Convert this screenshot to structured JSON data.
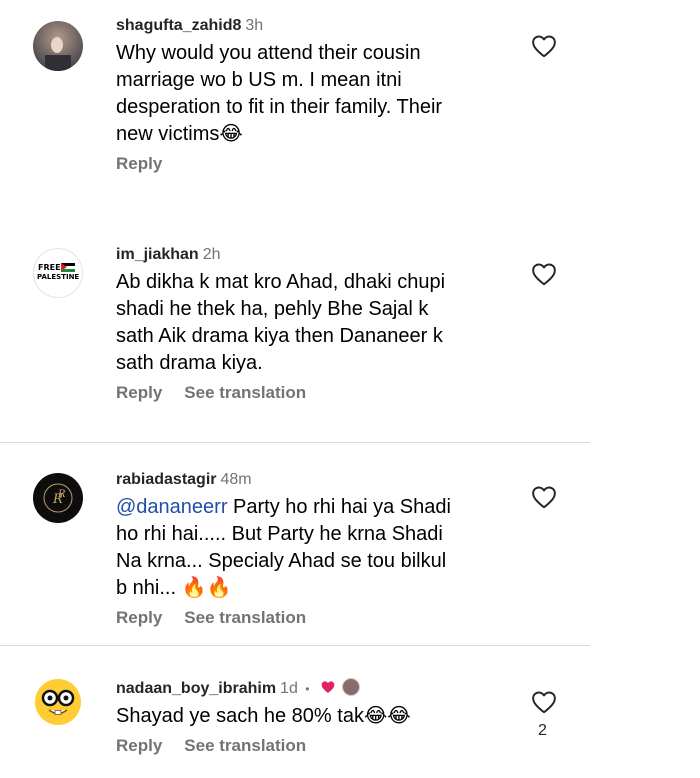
{
  "comments": [
    {
      "username": "shagufta_zahid8",
      "time": "3h",
      "lines": [
        "Why would you attend their cousin",
        "marriage wo b US m. I mean itni",
        "desperation to fit in their family. Their",
        "new victims😂"
      ],
      "reply_label": "Reply"
    },
    {
      "username": "im_jiakhan",
      "time": "2h",
      "avatar_text": [
        "FREE",
        "PALESTINE"
      ],
      "lines": [
        "Ab dikha k mat kro Ahad, dhaki chupi",
        "shadi he thek ha, pehly Bhe Sajal k",
        "sath Aik drama kiya then Dananeer k",
        "sath drama kiya."
      ],
      "reply_label": "Reply",
      "translate_label": "See translation"
    },
    {
      "username": "rabiadastagir",
      "time": "48m",
      "mention": "@dananeerr",
      "first_line_rest": " Party ho rhi hai ya Shadi",
      "lines": [
        "ho rhi hai..... But Party he krna Shadi",
        "Na krna... Specialy Ahad se tou bilkul",
        "b nhi... 🔥🔥"
      ],
      "reply_label": "Reply",
      "translate_label": "See translation"
    },
    {
      "username": "nadaan_boy_ibrahim",
      "time": "1d",
      "dot": "•",
      "lines": [
        "Shayad ye sach he 80% tak😂😂"
      ],
      "reply_label": "Reply",
      "translate_label": "See translation",
      "like_count": "2"
    }
  ],
  "colors": {
    "username": "#262626",
    "secondary": "#737373",
    "mention": "#1f4fa8",
    "heart_red": "#e0245e"
  },
  "icons": [
    "heart-outline-icon",
    "creator-liked-heart-icon"
  ]
}
